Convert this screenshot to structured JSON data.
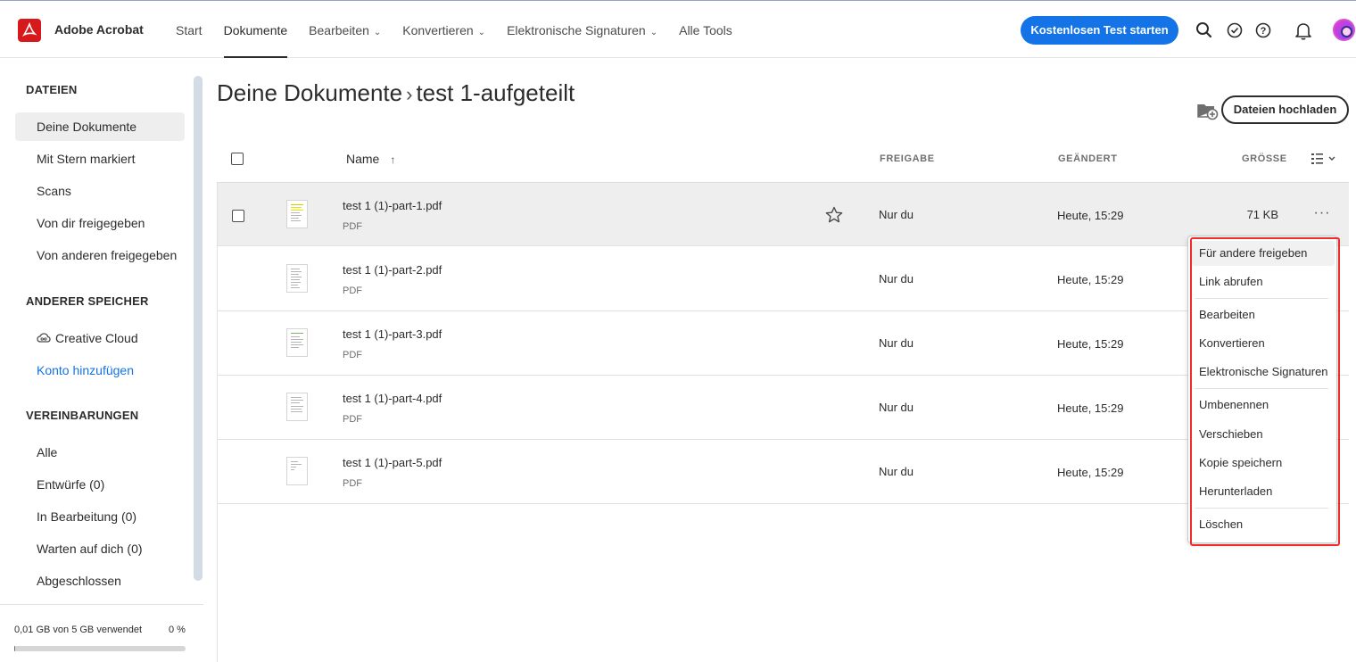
{
  "app": {
    "name": "Adobe Acrobat"
  },
  "nav": {
    "items": [
      {
        "label": "Start",
        "dropdown": false,
        "active": false
      },
      {
        "label": "Dokumente",
        "dropdown": false,
        "active": true
      },
      {
        "label": "Bearbeiten",
        "dropdown": true,
        "active": false
      },
      {
        "label": "Konvertieren",
        "dropdown": true,
        "active": false
      },
      {
        "label": "Elektronische Signaturen",
        "dropdown": true,
        "active": false
      },
      {
        "label": "Alle Tools",
        "dropdown": false,
        "active": false
      }
    ],
    "cta_label": "Kostenlosen Test starten"
  },
  "colors": {
    "accent": "#1473e6",
    "brand": "#d7191c",
    "highlight": "#ef2b2b"
  },
  "sidebar": {
    "files_heading": "DATEIEN",
    "files": [
      {
        "label": "Deine Dokumente",
        "active": true
      },
      {
        "label": "Mit Stern markiert"
      },
      {
        "label": "Scans"
      },
      {
        "label": "Von dir freigegeben"
      },
      {
        "label": "Von anderen freigegeben"
      }
    ],
    "storage_heading": "ANDERER SPEICHER",
    "creative_cloud_label": "Creative Cloud",
    "add_account_label": "Konto hinzufügen",
    "agreements_heading": "VEREINBARUNGEN",
    "agreements": [
      {
        "label": "Alle"
      },
      {
        "label": "Entwürfe (0)"
      },
      {
        "label": "In Bearbeitung (0)"
      },
      {
        "label": "Warten auf dich (0)"
      },
      {
        "label": "Abgeschlossen"
      }
    ],
    "storage_usage": "0,01 GB von 5 GB verwendet",
    "storage_percent": "0 %",
    "storage_fraction": 0.002
  },
  "main": {
    "breadcrumb_root": "Deine Dokumente",
    "breadcrumb_sep": "›",
    "breadcrumb_current": "test 1-aufgeteilt",
    "upload_label": "Dateien hochladen",
    "columns": {
      "name": "Name",
      "share": "FREIGABE",
      "modified": "GEÄNDERT",
      "size": "GRÖSSE"
    },
    "files": [
      {
        "name": "test 1 (1)-part-1.pdf",
        "type": "PDF",
        "share": "Nur du",
        "modified": "Heute, 15:29",
        "size": "71 KB"
      },
      {
        "name": "test 1 (1)-part-2.pdf",
        "type": "PDF",
        "share": "Nur du",
        "modified": "Heute, 15:29",
        "size": ""
      },
      {
        "name": "test 1 (1)-part-3.pdf",
        "type": "PDF",
        "share": "Nur du",
        "modified": "Heute, 15:29",
        "size": ""
      },
      {
        "name": "test 1 (1)-part-4.pdf",
        "type": "PDF",
        "share": "Nur du",
        "modified": "Heute, 15:29",
        "size": ""
      },
      {
        "name": "test 1 (1)-part-5.pdf",
        "type": "PDF",
        "share": "Nur du",
        "modified": "Heute, 15:29",
        "size": ""
      }
    ]
  },
  "context_menu": {
    "items": [
      "Für andere freigeben",
      "Link abrufen",
      "Bearbeiten",
      "Konvertieren",
      "Elektronische Signaturen",
      "Umbenennen",
      "Verschieben",
      "Kopie speichern",
      "Herunterladen",
      "Löschen"
    ]
  }
}
